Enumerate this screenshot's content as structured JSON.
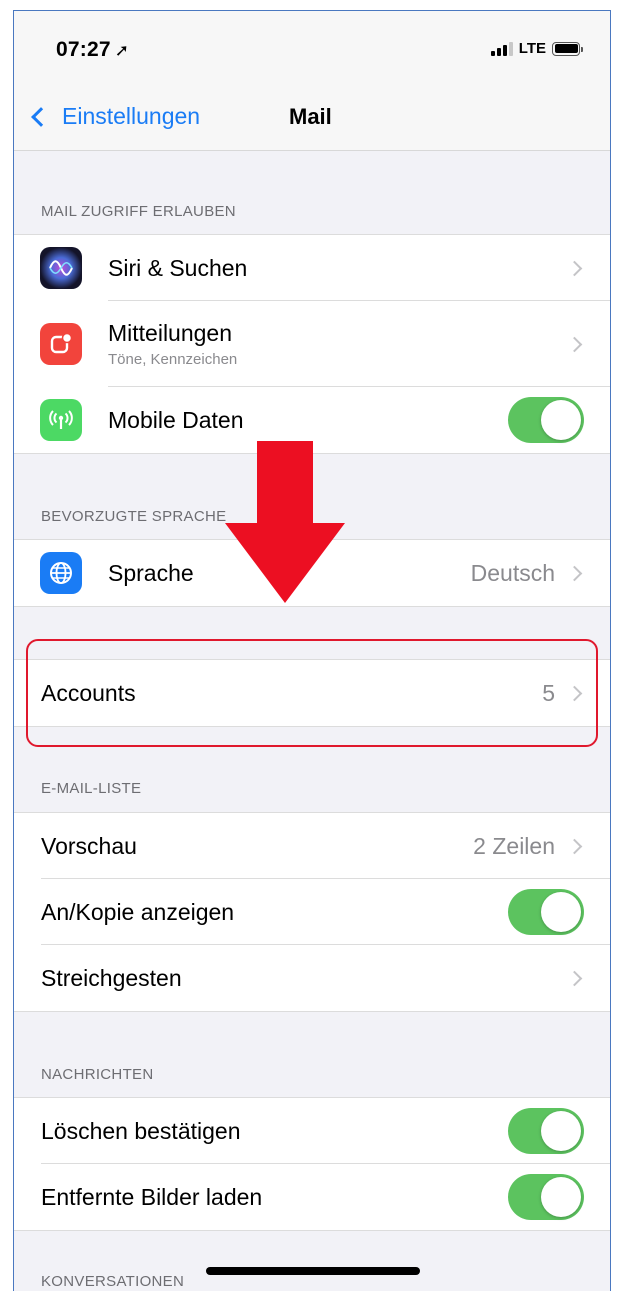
{
  "status": {
    "time": "07:27",
    "network": "LTE"
  },
  "nav": {
    "back_label": "Einstellungen",
    "title": "Mail"
  },
  "section_access": {
    "header": "MAIL ZUGRIFF ERLAUBEN",
    "siri": "Siri & Suchen",
    "notifications": "Mitteilungen",
    "notifications_sub": "Töne, Kennzeichen",
    "mobile_data": "Mobile Daten"
  },
  "section_language": {
    "header": "BEVORZUGTE SPRACHE",
    "language_label": "Sprache",
    "language_value": "Deutsch"
  },
  "accounts": {
    "label": "Accounts",
    "count": "5"
  },
  "section_list": {
    "header": "E-MAIL-LISTE",
    "preview_label": "Vorschau",
    "preview_value": "2 Zeilen",
    "show_to_cc": "An/Kopie anzeigen",
    "swipe": "Streichgesten"
  },
  "section_messages": {
    "header": "NACHRICHTEN",
    "ask_delete": "Löschen bestätigen",
    "load_remote": "Entfernte Bilder laden"
  },
  "section_threading": {
    "header": "KONVERSATIONEN"
  },
  "toggles": {
    "mobile_data": true,
    "show_to_cc": true,
    "ask_delete": true,
    "load_remote": true
  },
  "colors": {
    "accent": "#1a7cf5",
    "toggle_on": "#5cc35f",
    "annotation": "#ec0f22"
  },
  "icons": {
    "siri": "siri-icon",
    "notifications": "notifications-icon",
    "mobile_data": "antenna-icon",
    "language": "globe-icon"
  }
}
